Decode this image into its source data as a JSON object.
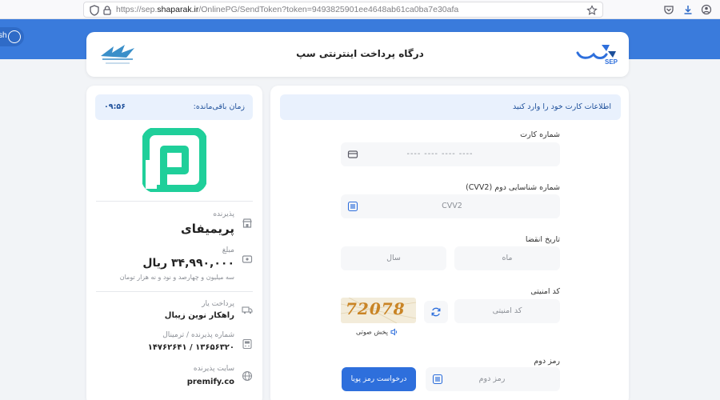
{
  "browser": {
    "url_prefix": "https://sep.",
    "url_domain": "shaparak.ir",
    "url_path": "/OnlinePG/SendToken?token=9493825901ee4648ab61ca0ba7e30afa"
  },
  "extension": {
    "label": "sh"
  },
  "header": {
    "title": "درگاه پرداخت اینترنتی سپ",
    "brand_logo_text": "SEP"
  },
  "form": {
    "info_text": "اطلاعات کارت خود را وارد کنید",
    "card_number": {
      "label": "شماره کارت",
      "placeholder": "---- ---- ---- ----"
    },
    "cvv2": {
      "label": "شماره شناسایی دوم (CVV2)",
      "placeholder": "CVV2"
    },
    "expiry": {
      "label": "تاریخ انقضا",
      "month_placeholder": "ماه",
      "year_placeholder": "سال"
    },
    "captcha": {
      "label": "کد امنیتی",
      "placeholder": "کد امنیتی",
      "image_text": "72078",
      "audio_label": "پخش صوتی"
    },
    "otp": {
      "label": "رمز دوم",
      "placeholder": "رمز دوم",
      "request_button": "درخواست رمز پویا"
    }
  },
  "sidebar": {
    "timer_label": "زمان باقی‌مانده:",
    "timer_value": "۰۹:۵۶",
    "merchant_label": "پذیرنده",
    "merchant_name": "پریمیفای",
    "amount_label": "مبلغ",
    "amount_value": "۳۴,۹۹۰,۰۰۰ ریال",
    "amount_words": "سه میلیون و چهارصد و نود و نه هزار تومان",
    "psp_label": "پرداخت یار",
    "psp_value": "راهکار نوین زیبال",
    "terminal_label": "شماره پذیرنده / ترمینال",
    "terminal_value": "۱۳۶۵۶۳۲۰ / ۱۴۷۶۲۶۴۱",
    "site_label": "سایت پذیرنده",
    "site_value": "premify.co"
  },
  "colors": {
    "brand_blue": "#3a7bdc",
    "button_blue": "#2e6fdc",
    "merchant_green": "#1fcf9a",
    "info_bg": "#e9f1fd"
  },
  "icons": [
    "shield-icon",
    "page-icon",
    "lock-icon",
    "star-icon",
    "pocket-icon",
    "download-icon",
    "settings-icon",
    "card-icon",
    "keypad-icon",
    "refresh-icon",
    "speaker-icon",
    "store-icon",
    "wallet-icon",
    "truck-icon",
    "terminal-icon",
    "globe-icon"
  ]
}
